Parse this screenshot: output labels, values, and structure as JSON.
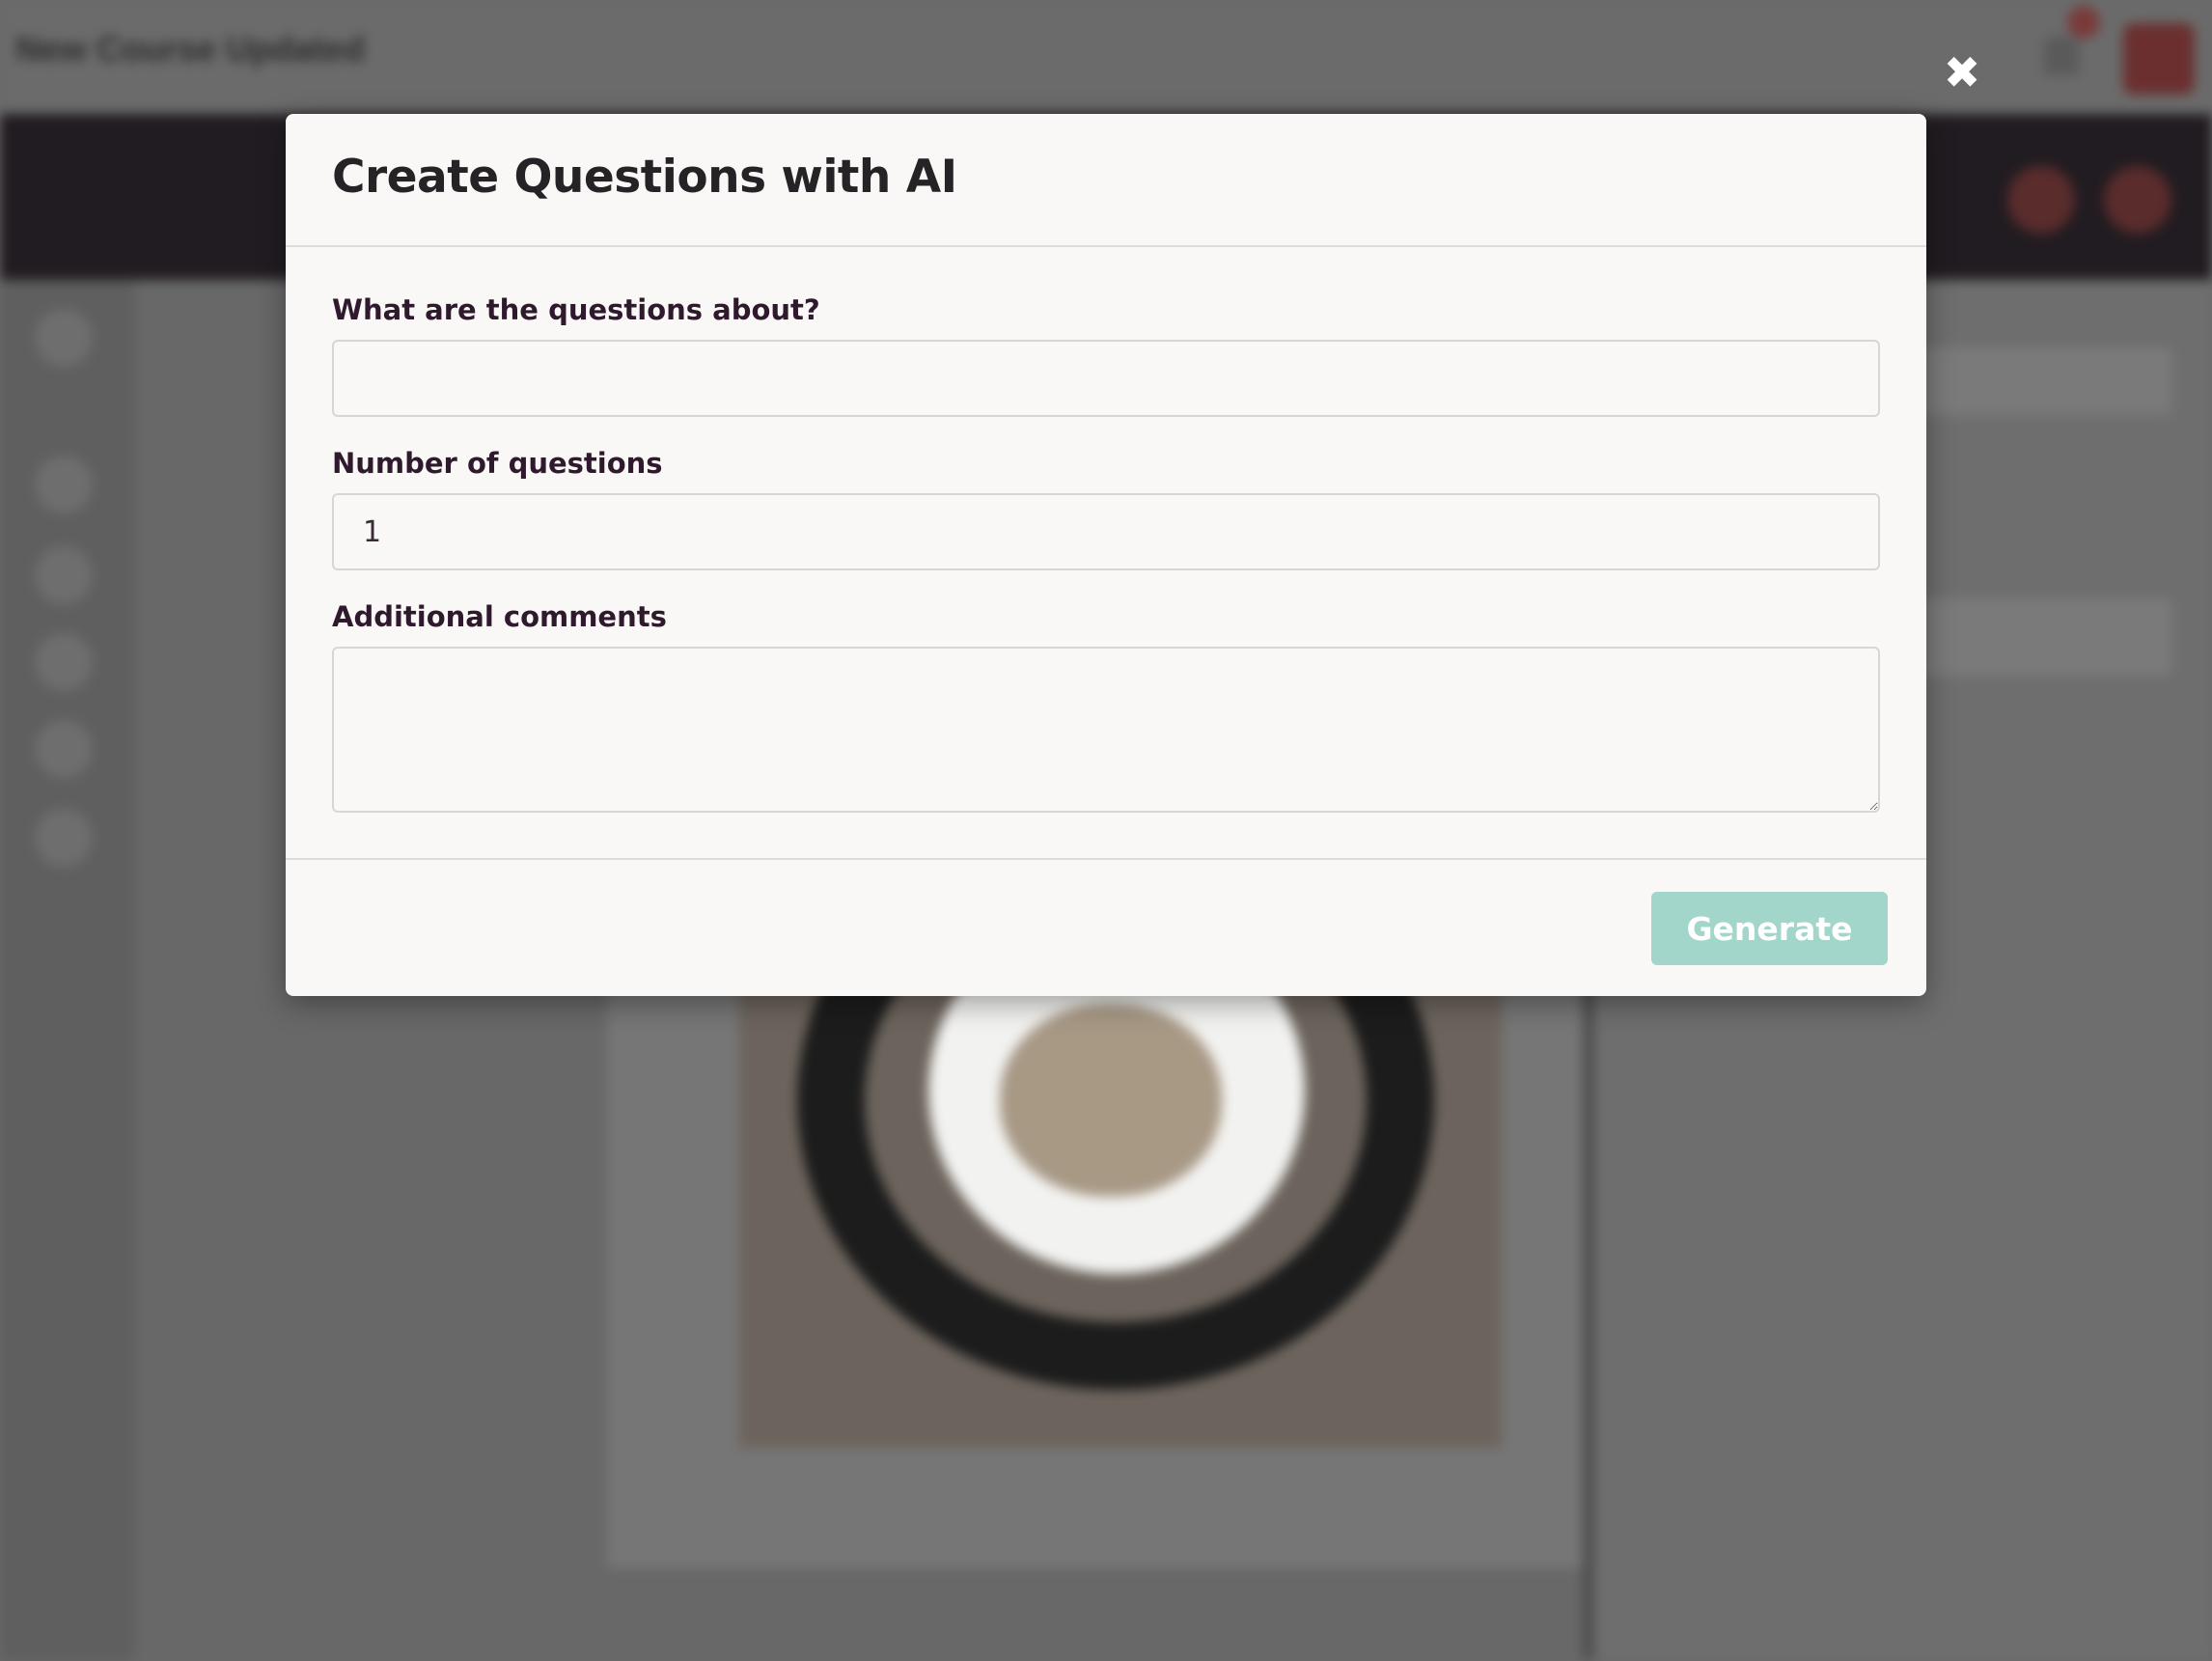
{
  "background": {
    "page_title": "New Course Updated"
  },
  "modal": {
    "close_icon": "close-icon",
    "title": "Create Questions with AI",
    "fields": {
      "topic": {
        "label": "What are the questions about?",
        "value": ""
      },
      "count": {
        "label": "Number of questions",
        "value": "1"
      },
      "comments": {
        "label": "Additional comments",
        "value": ""
      }
    },
    "generate_label": "Generate",
    "generate_color": "#a2d6cb"
  }
}
